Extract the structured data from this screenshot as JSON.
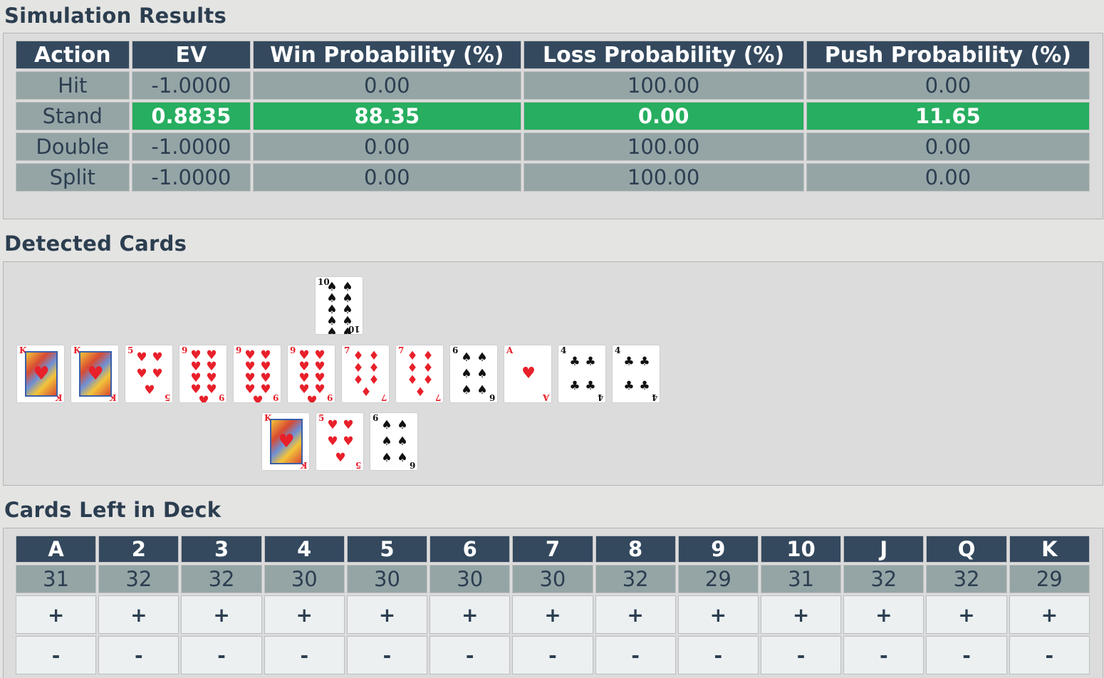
{
  "results": {
    "title": "Simulation Results",
    "headers": [
      "Action",
      "EV",
      "Win Probability (%)",
      "Loss Probability (%)",
      "Push Probability (%)"
    ],
    "rows": [
      {
        "action": "Hit",
        "ev": "-1.0000",
        "win": "0.00",
        "loss": "100.00",
        "push": "0.00",
        "best": false
      },
      {
        "action": "Stand",
        "ev": "0.8835",
        "win": "88.35",
        "loss": "0.00",
        "push": "11.65",
        "best": true
      },
      {
        "action": "Double",
        "ev": "-1.0000",
        "win": "0.00",
        "loss": "100.00",
        "push": "0.00",
        "best": false
      },
      {
        "action": "Split",
        "ev": "-1.0000",
        "win": "0.00",
        "loss": "100.00",
        "push": "0.00",
        "best": false
      }
    ],
    "highlight_color": "#27ae60",
    "header_color": "#34495e",
    "cell_color": "#95a5a6"
  },
  "detected": {
    "title": "Detected Cards",
    "dealer": [
      {
        "rank": "10",
        "suit": "spades"
      }
    ],
    "table": [
      {
        "rank": "K",
        "suit": "hearts"
      },
      {
        "rank": "K",
        "suit": "hearts"
      },
      {
        "rank": "5",
        "suit": "hearts"
      },
      {
        "rank": "9",
        "suit": "hearts"
      },
      {
        "rank": "9",
        "suit": "hearts"
      },
      {
        "rank": "9",
        "suit": "hearts"
      },
      {
        "rank": "7",
        "suit": "diamonds"
      },
      {
        "rank": "7",
        "suit": "diamonds"
      },
      {
        "rank": "6",
        "suit": "spades"
      },
      {
        "rank": "A",
        "suit": "hearts"
      },
      {
        "rank": "4",
        "suit": "clubs"
      },
      {
        "rank": "4",
        "suit": "clubs"
      }
    ],
    "player": [
      {
        "rank": "K",
        "suit": "hearts"
      },
      {
        "rank": "5",
        "suit": "hearts"
      },
      {
        "rank": "6",
        "suit": "spades"
      }
    ]
  },
  "deck": {
    "title": "Cards Left in Deck",
    "ranks": [
      "A",
      "2",
      "3",
      "4",
      "5",
      "6",
      "7",
      "8",
      "9",
      "10",
      "J",
      "Q",
      "K"
    ],
    "counts": [
      "31",
      "32",
      "32",
      "30",
      "30",
      "30",
      "30",
      "32",
      "29",
      "31",
      "32",
      "32",
      "29"
    ],
    "plus_label": "+",
    "minus_label": "-"
  }
}
